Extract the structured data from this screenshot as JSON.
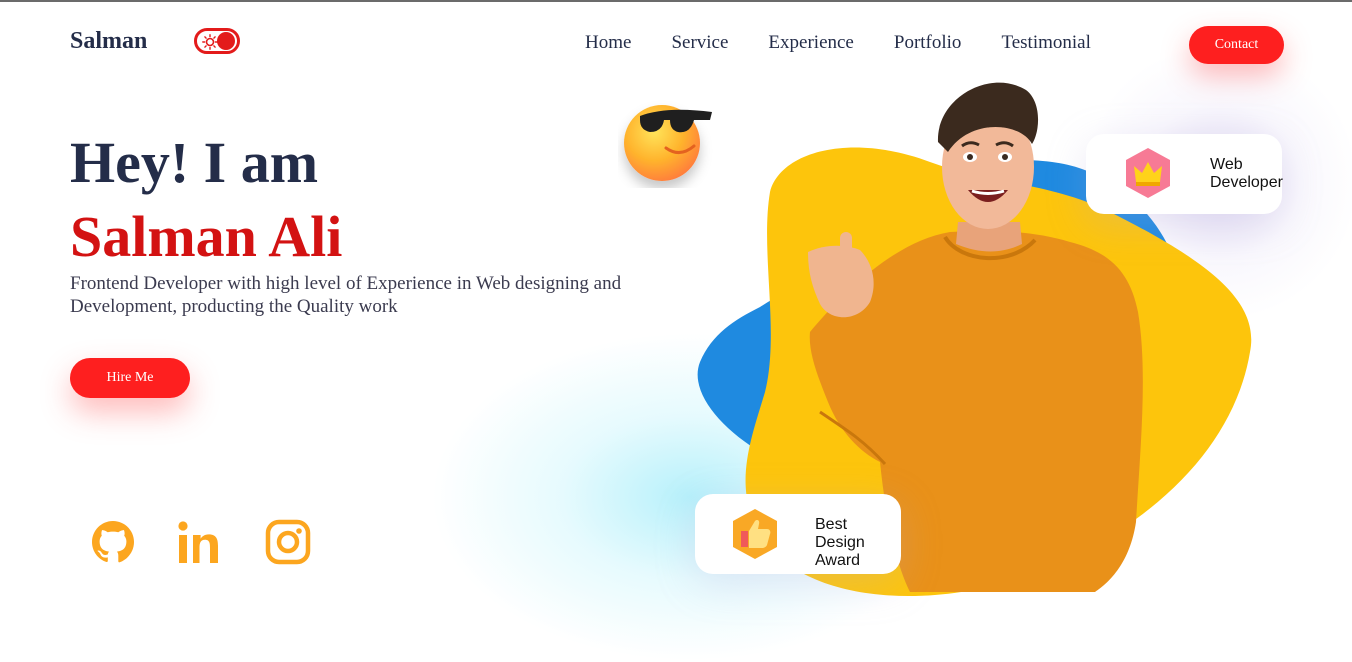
{
  "brand": "Salman",
  "theme_toggle": {
    "state": "light"
  },
  "nav": {
    "items": [
      "Home",
      "Service",
      "Experience",
      "Portfolio",
      "Testimonial"
    ],
    "contact_label": "Contact"
  },
  "hero": {
    "greeting": "Hey! I am",
    "name": "Salman Ali",
    "description": "Frontend Developer with high level of Experience in Web designing and Development, producting the Quality work",
    "cta_label": "Hire Me"
  },
  "social": [
    {
      "icon": "github-icon"
    },
    {
      "icon": "linkedin-icon"
    },
    {
      "icon": "instagram-icon"
    }
  ],
  "cards": {
    "web_developer": {
      "line1": "Web",
      "line2": "Developer",
      "icon": "crown-icon"
    },
    "best_design": {
      "line1": "Best Design",
      "line2": "Award",
      "icon": "thumbs-up-icon"
    }
  },
  "colors": {
    "accent": "#fe1f1f",
    "heading": "#242d49",
    "name": "#d31212",
    "blob_yellow": "#fdc50c",
    "blob_blue": "#1f8ae0",
    "social_orange": "#fca61f"
  }
}
